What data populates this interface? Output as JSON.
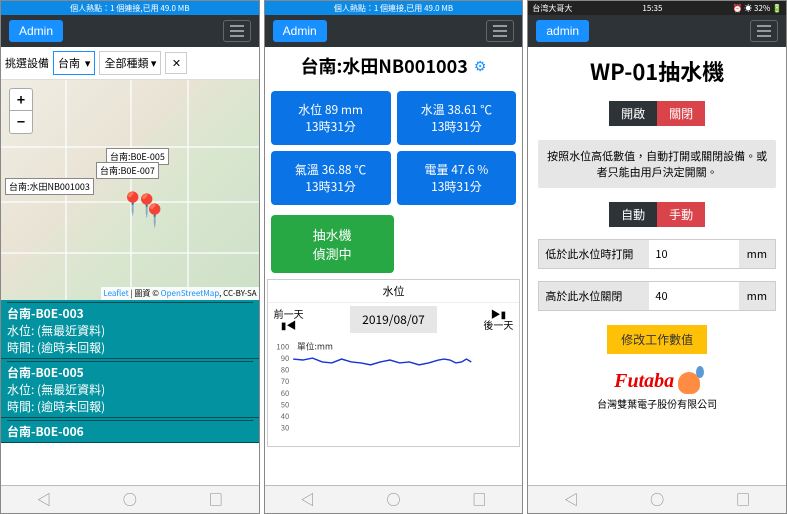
{
  "status_text": "個人熱點：1 個連接,已用 49.0 MB",
  "status_right": {
    "carrier": "台湾大哥大",
    "time": "15:35",
    "battery": "32%"
  },
  "admin_label": "Admin",
  "admin_label_lc": "admin",
  "p1": {
    "filter_label": "挑選設備",
    "region": "台南",
    "type": "全部種類",
    "zoom_in": "+",
    "zoom_out": "−",
    "marker_labels": [
      "台南:B0E-005",
      "台南:B0E-007",
      "台南:水田NB001003"
    ],
    "attr": {
      "leaflet": "Leaflet",
      "mid": " | 圖資 © ",
      "osm": "OpenStreetMap",
      "lic": ", CC-BY-SA"
    },
    "list": [
      {
        "title": "台南-B0E-003",
        "l1": "水位: (無最近資料)",
        "l2": "時間: (逾時未回報)"
      },
      {
        "title": "台南-B0E-005",
        "l1": "水位: (無最近資料)",
        "l2": "時間: (逾時未回報)"
      },
      {
        "title": "台南-B0E-006"
      }
    ]
  },
  "p2": {
    "title": "台南:水田NB001003",
    "cards": [
      {
        "l1": "水位 89 mm",
        "l2": "13時31分"
      },
      {
        "l1": "水溫 38.61 ℃",
        "l2": "13時31分"
      },
      {
        "l1": "氣溫 36.88 ℃",
        "l2": "13時31分"
      },
      {
        "l1": "電量 47.6 %",
        "l2": "13時31分"
      }
    ],
    "pump": {
      "l1": "抽水機",
      "l2": "偵測中"
    },
    "chart_title": "水位",
    "prev": "前一天",
    "next": "後一天",
    "date": "2019/08/07",
    "unit_label": "單位:mm"
  },
  "p3": {
    "title": "WP-01抽水機",
    "on": "開啟",
    "off": "關閉",
    "desc": "按照水位高低數值，自動打開或關閉設備。或者只能由用戶決定開關。",
    "auto": "自動",
    "manual": "手動",
    "rows": [
      {
        "label": "低於此水位時打開",
        "value": "10",
        "unit": "mm"
      },
      {
        "label": "高於此水位關閉",
        "value": "40",
        "unit": "mm"
      }
    ],
    "modify": "修改工作數值",
    "brand": "Futaba",
    "company": "台灣雙葉電子股份有限公司"
  },
  "chart_data": {
    "type": "line",
    "title": "水位",
    "ylabel": "單位:mm",
    "ylim": [
      30,
      100
    ],
    "y_ticks": [
      30,
      40,
      50,
      60,
      70,
      80,
      90,
      100
    ],
    "series": [
      {
        "name": "水位",
        "values": [
          90,
          89,
          91,
          88,
          87,
          90,
          88,
          87,
          86,
          88,
          89,
          87,
          88,
          86,
          87,
          89,
          90,
          89,
          87,
          88,
          90,
          88
        ]
      }
    ]
  }
}
